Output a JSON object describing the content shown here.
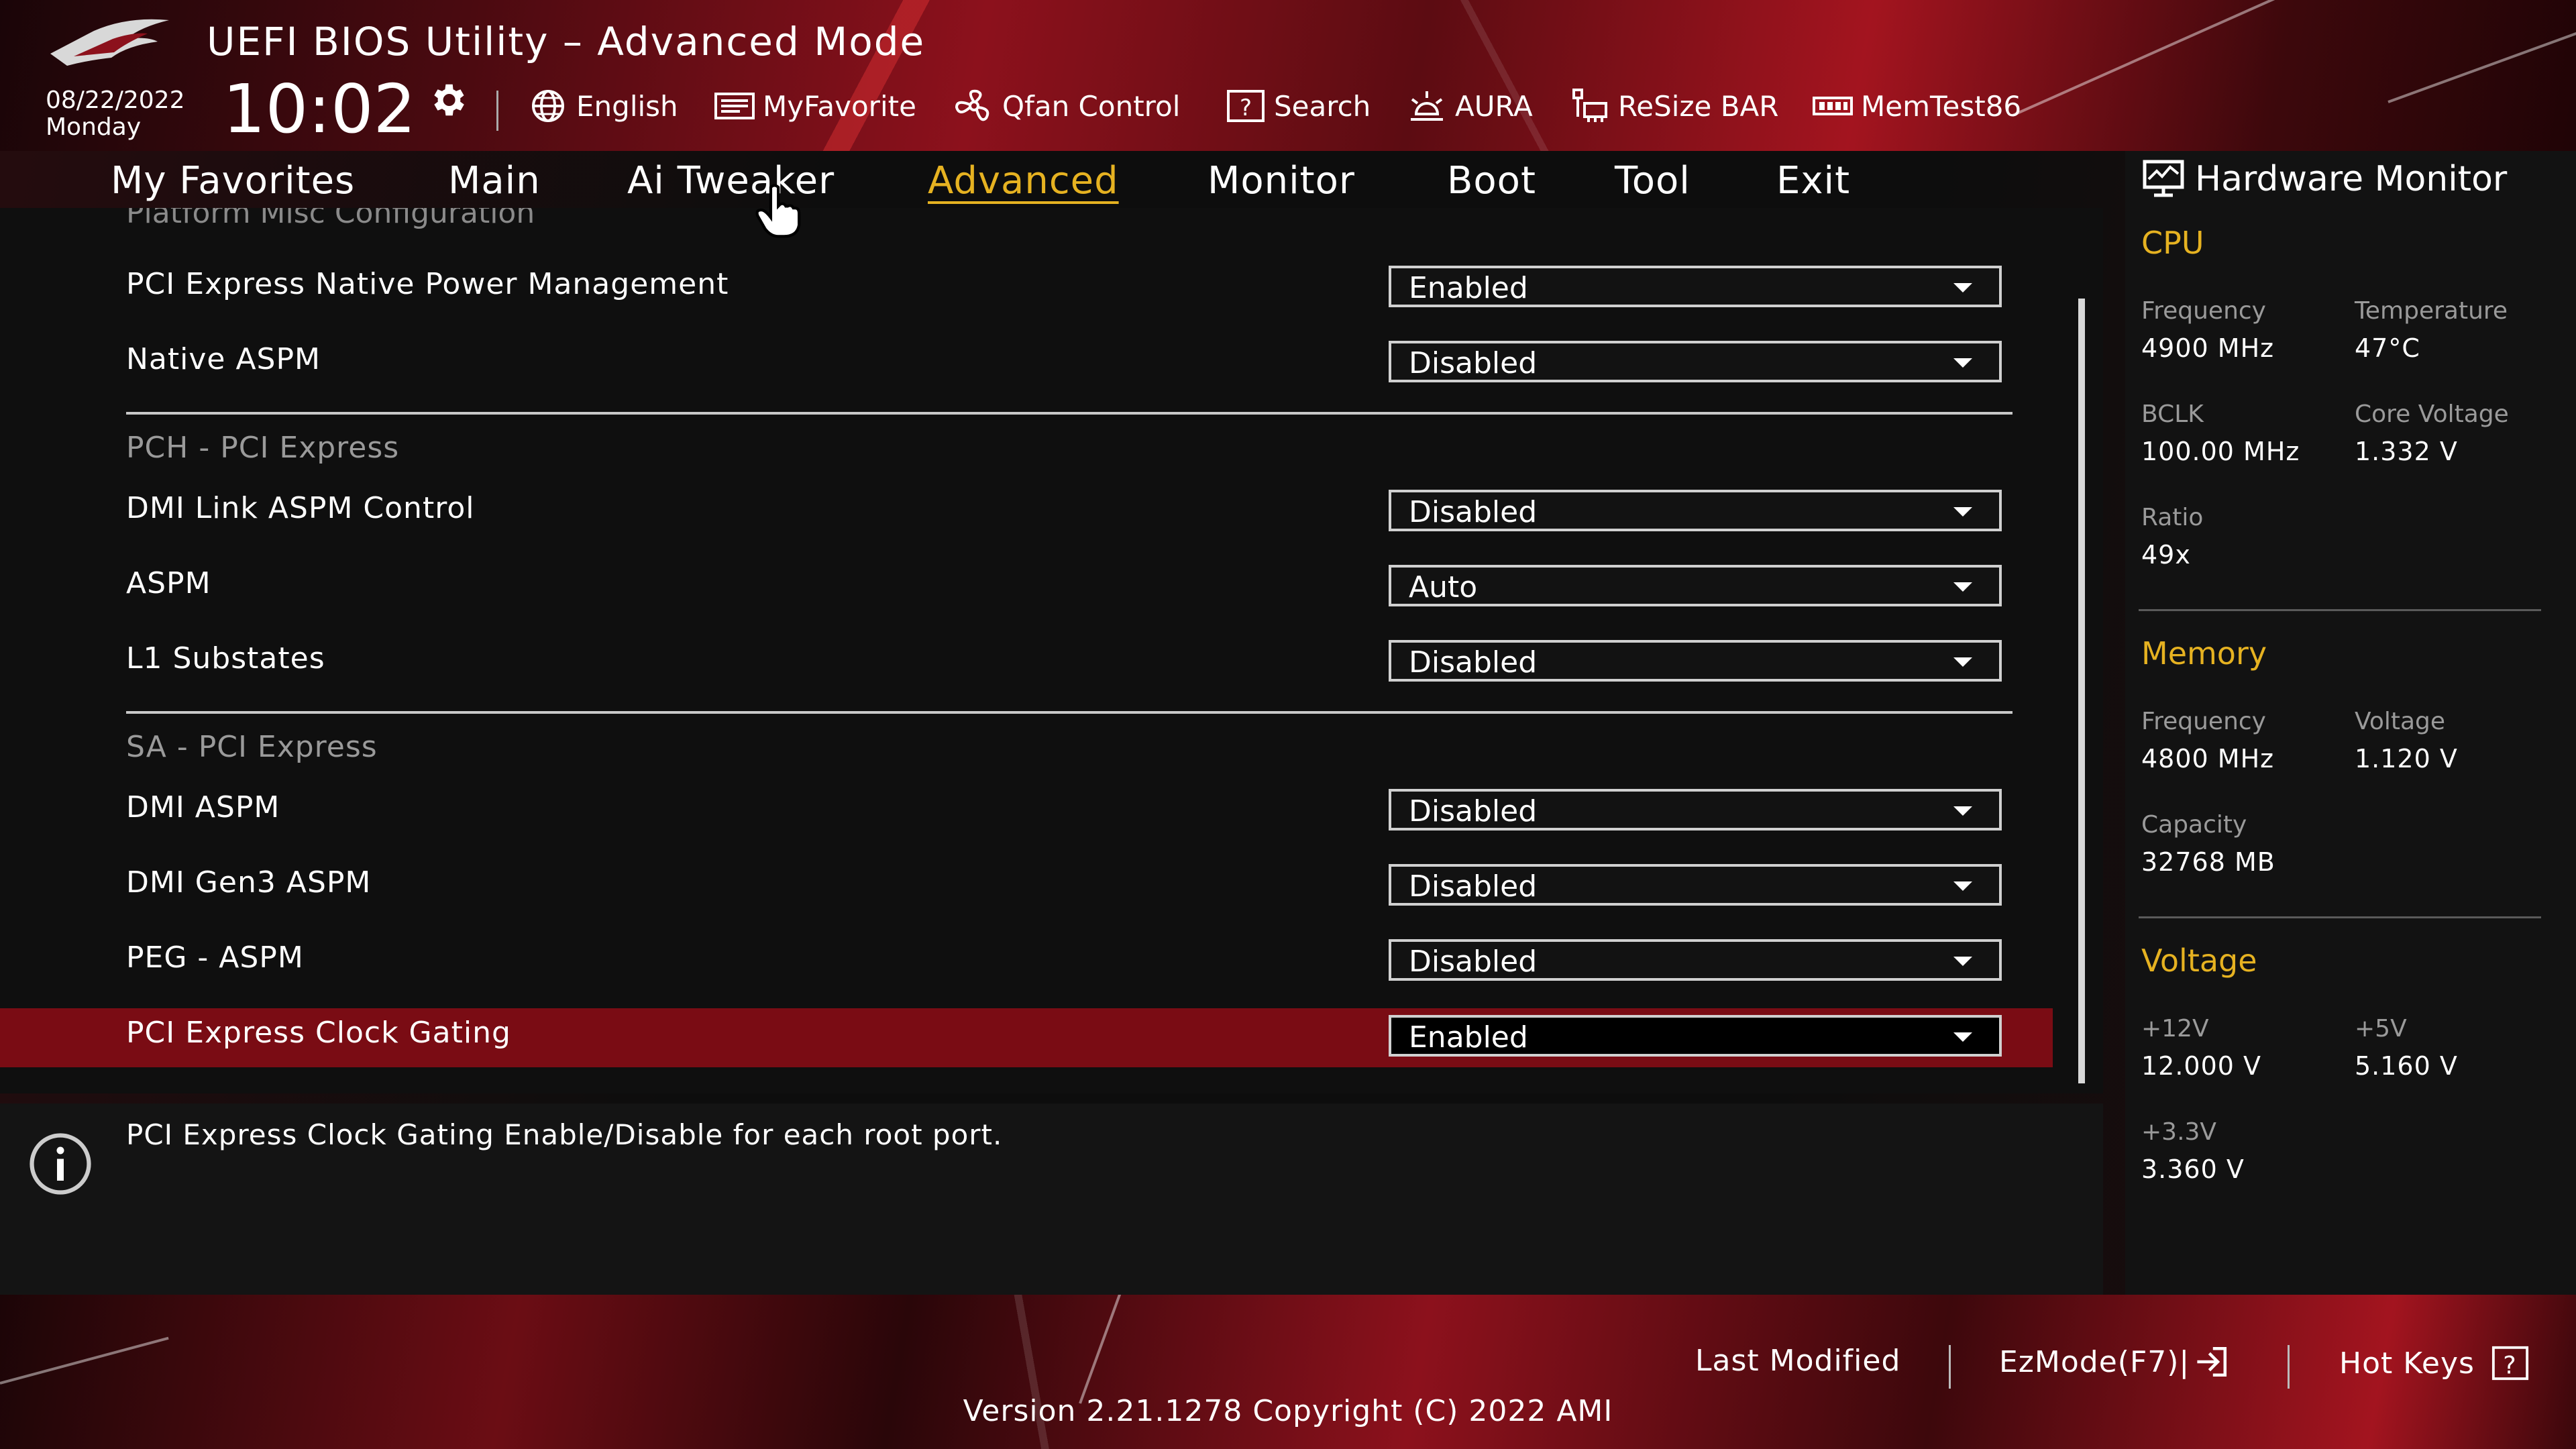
{
  "header": {
    "title": "UEFI BIOS Utility – Advanced Mode",
    "date": "08/22/2022",
    "day": "Monday",
    "time": "10:02",
    "toolbar": [
      {
        "label": "English",
        "icon": "globe-icon"
      },
      {
        "label": "MyFavorite",
        "icon": "myfavorite-icon"
      },
      {
        "label": "Qfan Control",
        "icon": "fan-icon"
      },
      {
        "label": "Search",
        "icon": "search-question-icon"
      },
      {
        "label": "AURA",
        "icon": "aura-icon"
      },
      {
        "label": "ReSize BAR",
        "icon": "resize-bar-icon"
      },
      {
        "label": "MemTest86",
        "icon": "memtest-icon"
      }
    ]
  },
  "tabs": [
    {
      "label": "My Favorites"
    },
    {
      "label": "Main"
    },
    {
      "label": "Ai Tweaker"
    },
    {
      "label": "Advanced",
      "active": true
    },
    {
      "label": "Monitor"
    },
    {
      "label": "Boot"
    },
    {
      "label": "Tool"
    },
    {
      "label": "Exit"
    }
  ],
  "main": {
    "clipped_title": "Platform Misc Configuration",
    "items": [
      {
        "label": "PCI Express Native Power Management",
        "value": "Enabled"
      },
      {
        "label": "Native ASPM",
        "value": "Disabled"
      },
      {
        "label": "DMI Link ASPM Control",
        "value": "Disabled"
      },
      {
        "label": "ASPM",
        "value": "Auto"
      },
      {
        "label": "L1 Substates",
        "value": "Disabled"
      },
      {
        "label": "DMI ASPM",
        "value": "Disabled"
      },
      {
        "label": "DMI Gen3 ASPM",
        "value": "Disabled"
      },
      {
        "label": "PEG - ASPM",
        "value": "Disabled"
      },
      {
        "label": "PCI Express Clock Gating",
        "value": "Enabled",
        "selected": true
      }
    ],
    "sections": [
      "PCH - PCI Express",
      "SA - PCI Express"
    ]
  },
  "help": {
    "text": "PCI Express Clock Gating Enable/Disable for each root port."
  },
  "hardware_monitor": {
    "title": "Hardware Monitor",
    "cpu": {
      "heading": "CPU",
      "frequency_label": "Frequency",
      "frequency": "4900 MHz",
      "temperature_label": "Temperature",
      "temperature": "47°C",
      "bclk_label": "BCLK",
      "bclk": "100.00 MHz",
      "core_voltage_label": "Core Voltage",
      "core_voltage": "1.332 V",
      "ratio_label": "Ratio",
      "ratio": "49x"
    },
    "memory": {
      "heading": "Memory",
      "frequency_label": "Frequency",
      "frequency": "4800 MHz",
      "voltage_label": "Voltage",
      "voltage": "1.120 V",
      "capacity_label": "Capacity",
      "capacity": "32768 MB"
    },
    "voltage": {
      "heading": "Voltage",
      "v12_label": "+12V",
      "v12": "12.000 V",
      "v5_label": "+5V",
      "v5": "5.160 V",
      "v33_label": "+3.3V",
      "v33": "3.360 V"
    }
  },
  "footer": {
    "last_modified": "Last Modified",
    "ezmode": "EzMode(F7)|",
    "hot_keys": "Hot Keys",
    "version": "Version 2.21.1278 Copyright (C) 2022 AMI"
  },
  "colors": {
    "accent": "#e6b221",
    "selection": "#7a0c14",
    "brand_red": "#8c111c"
  }
}
